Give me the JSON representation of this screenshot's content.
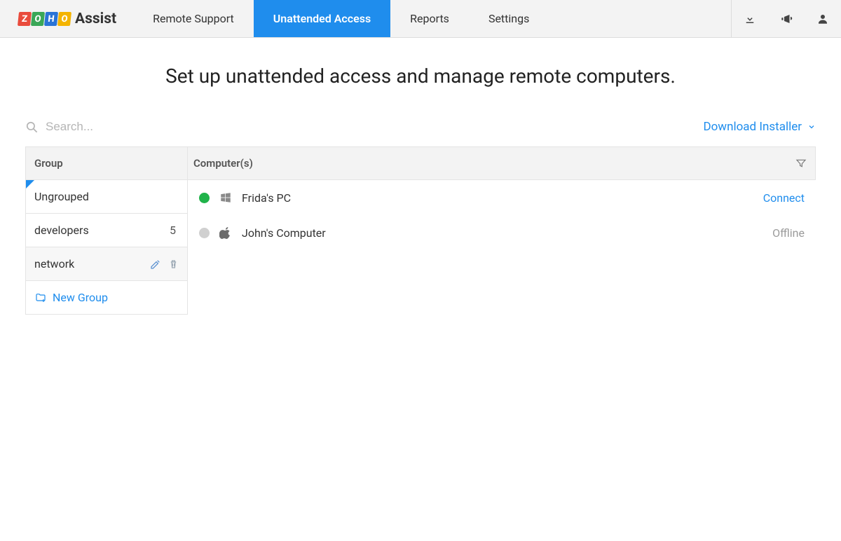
{
  "brand": {
    "zoho": [
      "Z",
      "O",
      "H",
      "O"
    ],
    "product": "Assist"
  },
  "nav": {
    "remote_support": "Remote Support",
    "unattended_access": "Unattended Access",
    "reports": "Reports",
    "settings": "Settings"
  },
  "page": {
    "title": "Set up unattended access and manage remote computers."
  },
  "toolbar": {
    "search_placeholder": "Search...",
    "download_installer": "Download Installer"
  },
  "headers": {
    "group": "Group",
    "computers": "Computer(s)"
  },
  "groups": {
    "items": [
      {
        "label": "Ungrouped",
        "count": ""
      },
      {
        "label": "developers",
        "count": "5"
      },
      {
        "label": "network",
        "count": ""
      }
    ],
    "new_group": "New Group"
  },
  "computers": [
    {
      "name": "Frida's PC",
      "status": "online",
      "os": "windows",
      "action": "Connect"
    },
    {
      "name": "John's Computer",
      "status": "offline",
      "os": "apple",
      "action": "Offline"
    }
  ]
}
